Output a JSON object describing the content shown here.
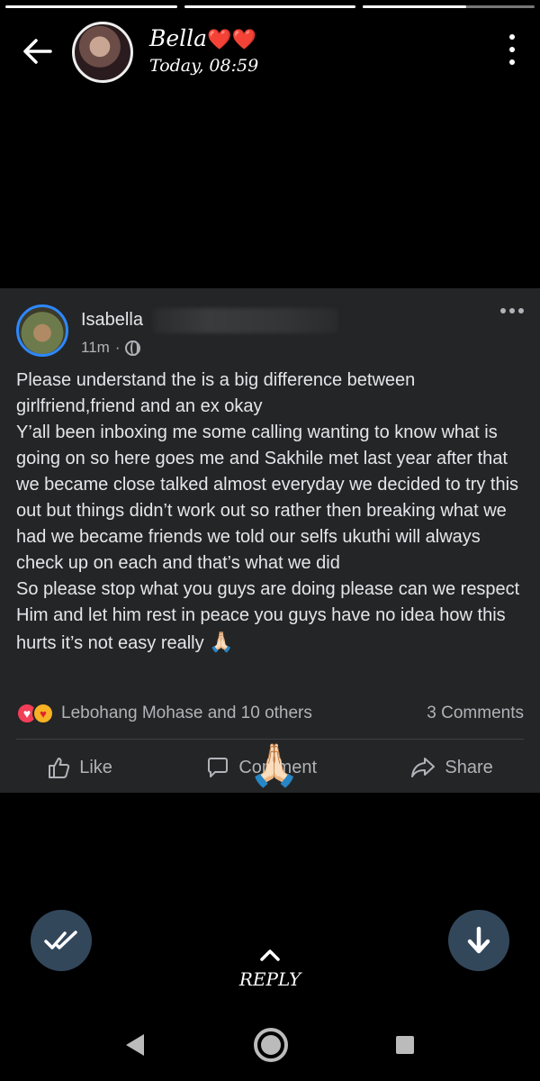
{
  "story": {
    "progress": [
      {
        "state": "complete"
      },
      {
        "state": "complete"
      },
      {
        "state": "current",
        "fraction": 0.6
      }
    ],
    "contact": {
      "name": "Bella",
      "name_suffix": "❤️❤️",
      "time": "Today, 08:59"
    }
  },
  "post": {
    "author": "Isabella",
    "time_ago": "11m",
    "separator": "·",
    "paragraphs": [
      "Please understand the is a big difference between girlfriend,friend and an ex okay",
      "Y’all been inboxing me some calling wanting to know what is going on so here goes me and Sakhile  met last year after that we became close talked almost everyday we decided to try this out but things didn’t work out so rather then breaking what we had we became friends we told our selfs ukuthi will always check up on each and that’s what we did",
      "So please stop what you guys are doing please can we respect Him and let him rest in peace you guys have no idea how this hurts it’s not easy really"
    ],
    "text_emoji": "🙏🏻",
    "reactions_text": "Lebohang Mohase and 10 others",
    "comments_text": "3 Comments",
    "actions": {
      "like": "Like",
      "comment": "Comment",
      "share": "Share"
    }
  },
  "sticker": "🙏🏻",
  "reply": {
    "label": "REPLY"
  },
  "icons": {
    "back": "arrow-left-icon",
    "menu": "kebab-menu-icon",
    "globe": "globe-icon",
    "seen": "double-check-icon",
    "scroll_down": "arrow-down-icon"
  },
  "colors": {
    "background": "#000000",
    "card": "#242526",
    "fab": "#33475b",
    "fb_blue": "#2d88ff",
    "love": "#f33e58"
  }
}
